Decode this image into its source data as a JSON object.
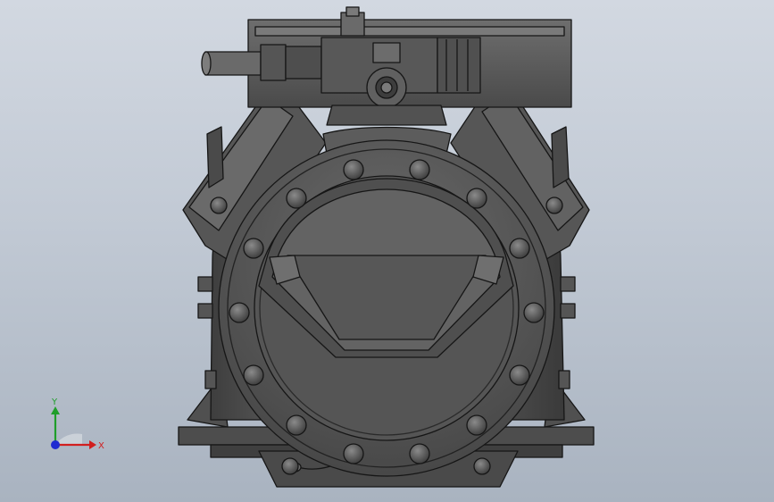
{
  "viewport": {
    "background_top": "#d2d8e1",
    "background_bottom": "#a9b3c0"
  },
  "model": {
    "description_icon": "compressor-3d-model",
    "body_color": "#5a5a5a",
    "edge_color": "#1a1a1a"
  },
  "triad": {
    "x_label": "X",
    "y_label": "Y",
    "x_color": "#d11f1f",
    "y_color": "#1f9e2a",
    "z_color": "#1f2ad1"
  }
}
